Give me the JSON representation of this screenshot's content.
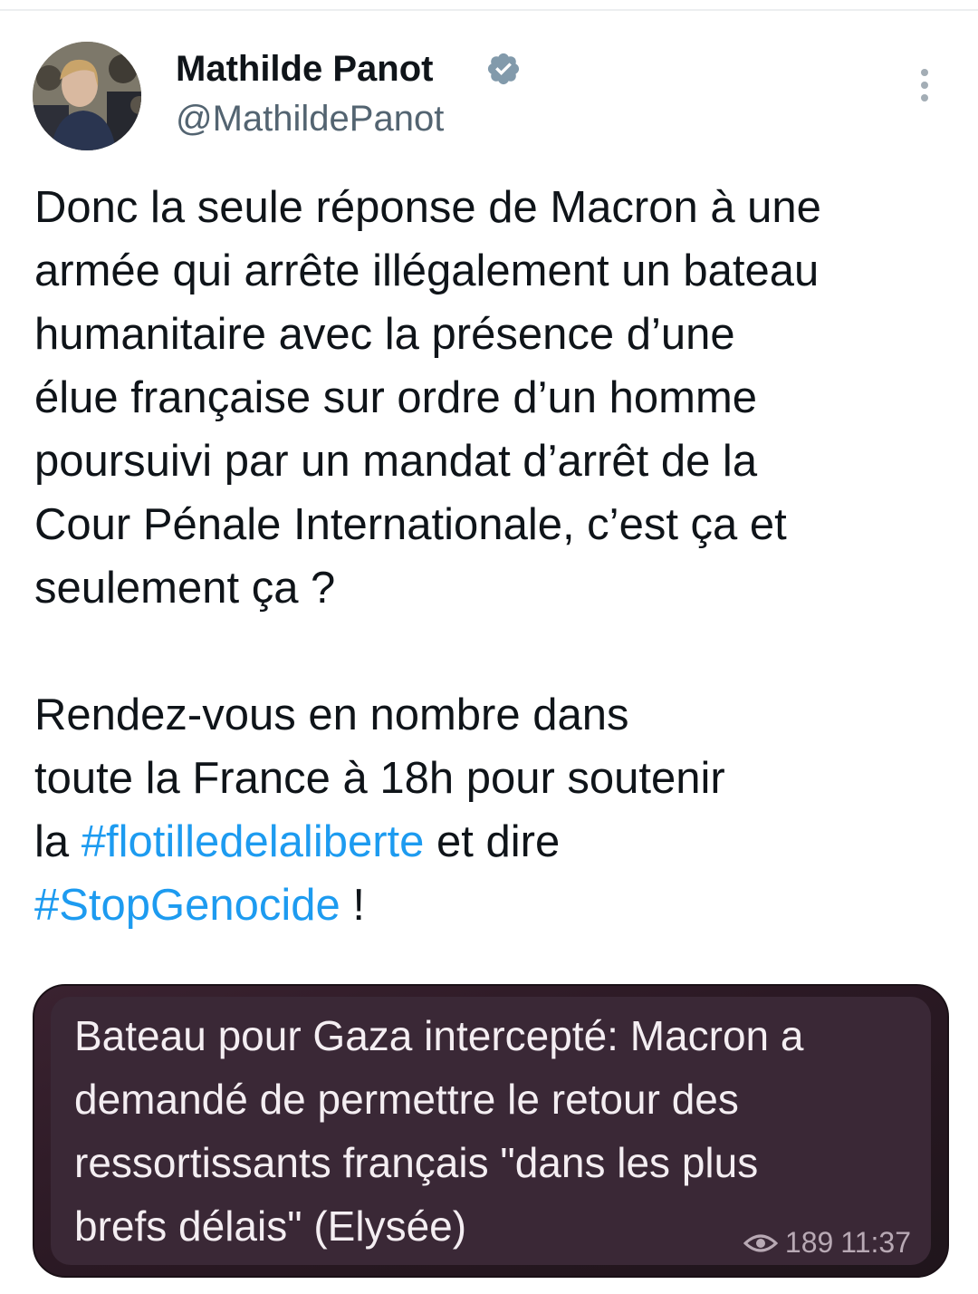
{
  "author": {
    "display_name": "Mathilde Panot",
    "handle": "@MathildePanot",
    "verified": true
  },
  "tweet": {
    "paragraph1_lines": [
      "Donc la seule réponse de Macron à une",
      "armée qui arrête illégalement un bateau",
      "humanitaire avec la présence d’une",
      "élue française sur ordre d’un homme",
      "poursuivi par un mandat d’arrêt de la",
      "Cour Pénale Internationale, c’est ça et",
      "seulement ça ?"
    ],
    "paragraph2_line1": "Rendez-vous en nombre dans",
    "paragraph2_line2": "toute la France à 18h pour soutenir",
    "paragraph2_line3_pre": "la ",
    "hashtag1": "#flotilledelaliberte",
    "paragraph2_line3_post": " et dire",
    "hashtag2": "#StopGenocide",
    "paragraph2_end": " !"
  },
  "media": {
    "lines": [
      "Bateau pour Gaza intercepté: Macron a",
      "demandé de permettre le retour des",
      "ressortissants français \"dans les plus",
      "brefs délais\" (Elysée)"
    ],
    "views": "189",
    "time": "11:37"
  },
  "colors": {
    "link": "#1d9bf0",
    "text": "#0f1419",
    "secondary": "#536471",
    "verified": "#829aab"
  }
}
